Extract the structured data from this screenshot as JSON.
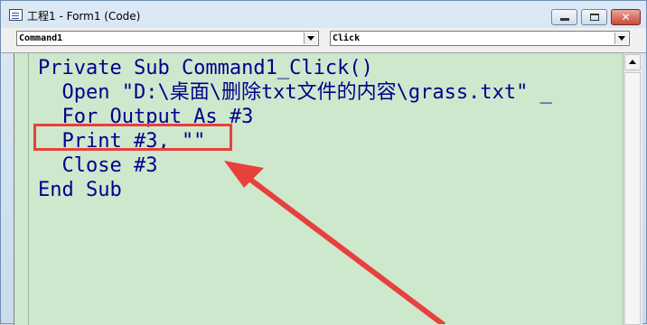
{
  "window": {
    "title": "工程1 - Form1 (Code)",
    "close_glyph": "✕"
  },
  "combos": {
    "object": "Command1",
    "procedure": "Click"
  },
  "code": {
    "lines": [
      "Private Sub Command1_Click()",
      "  Open \"D:\\桌面\\删除txt文件的内容\\grass.txt\" _",
      "  For Output As #3",
      "  Print #3, \"\"",
      "  Close #3",
      "End Sub"
    ]
  },
  "colors": {
    "highlight": "#e8403a",
    "editor_bg": "#cde8cd",
    "code_text": "#00008b"
  }
}
